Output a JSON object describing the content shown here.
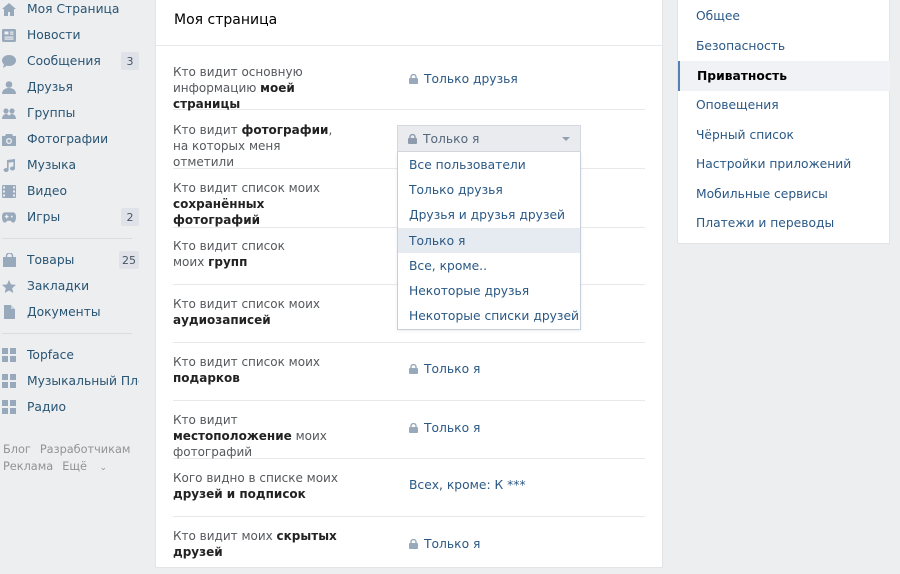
{
  "sidebar": {
    "items": [
      {
        "label": "Моя Страница",
        "icon": "home-icon",
        "badge": ""
      },
      {
        "label": "Новости",
        "icon": "news-icon",
        "badge": ""
      },
      {
        "label": "Сообщения",
        "icon": "messages-icon",
        "badge": "3"
      },
      {
        "label": "Друзья",
        "icon": "friends-icon",
        "badge": ""
      },
      {
        "label": "Группы",
        "icon": "groups-icon",
        "badge": ""
      },
      {
        "label": "Фотографии",
        "icon": "camera-icon",
        "badge": ""
      },
      {
        "label": "Музыка",
        "icon": "music-icon",
        "badge": ""
      },
      {
        "label": "Видео",
        "icon": "video-icon",
        "badge": ""
      },
      {
        "label": "Игры",
        "icon": "gamepad-icon",
        "badge": "2"
      },
      {
        "label": "Товары",
        "icon": "bag-icon",
        "badge": "25"
      },
      {
        "label": "Закладки",
        "icon": "star-icon",
        "badge": ""
      },
      {
        "label": "Документы",
        "icon": "document-icon",
        "badge": ""
      },
      {
        "label": "Topface",
        "icon": "app-grid-icon",
        "badge": ""
      },
      {
        "label": "Музыкальный Пле...",
        "icon": "app-grid-icon",
        "badge": ""
      },
      {
        "label": "Радио",
        "icon": "app-grid-icon",
        "badge": ""
      }
    ],
    "footer": {
      "blog": "Блог",
      "developers": "Разработчикам",
      "ads": "Реклама",
      "more": "Ещё"
    }
  },
  "main": {
    "title": "Моя страница",
    "rows": [
      {
        "label_pre": "Кто видит основную информацию ",
        "label_bold": "моей страницы",
        "label_post": "",
        "value": "Только друзья"
      },
      {
        "label_pre": "Кто видит ",
        "label_bold": "фотографии",
        "label_post": ", на которых меня отметили",
        "value": "Только я"
      },
      {
        "label_pre": "Кто видит список моих ",
        "label_bold": "сохранённых фотографий",
        "label_post": "",
        "value": ""
      },
      {
        "label_pre": "Кто видит список моих ",
        "label_bold": "групп",
        "label_post": "",
        "value": ""
      },
      {
        "label_pre": "Кто видит список моих ",
        "label_bold": "аудиозаписей",
        "label_post": "",
        "value": ""
      },
      {
        "label_pre": "Кто видит список моих ",
        "label_bold": "подарков",
        "label_post": "",
        "value": "Только я"
      },
      {
        "label_pre": "Кто видит ",
        "label_bold": "местоположение",
        "label_post": " моих фотографий",
        "value": "Только я"
      },
      {
        "label_pre": "Кого видно в списке моих ",
        "label_bold": "друзей и подписок",
        "label_post": "",
        "value": "Всех, кроме: К ***"
      },
      {
        "label_pre": "Кто видит моих ",
        "label_bold": "скрытых друзей",
        "label_post": "",
        "value": "Только я"
      }
    ],
    "dropdown": {
      "selected": "Только я",
      "options": [
        "Все пользователи",
        "Только друзья",
        "Друзья и друзья друзей",
        "Только я",
        "Все, кроме..",
        "Некоторые друзья",
        "Некоторые списки друзей"
      ]
    }
  },
  "settings_menu": {
    "items": [
      "Общее",
      "Безопасность",
      "Приватность",
      "Оповещения",
      "Чёрный список",
      "Настройки приложений",
      "Мобильные сервисы",
      "Платежи и переводы"
    ],
    "active": "Приватность"
  },
  "colors": {
    "link": "#2a5885",
    "accent": "#5181b8",
    "background": "#edeef0"
  }
}
